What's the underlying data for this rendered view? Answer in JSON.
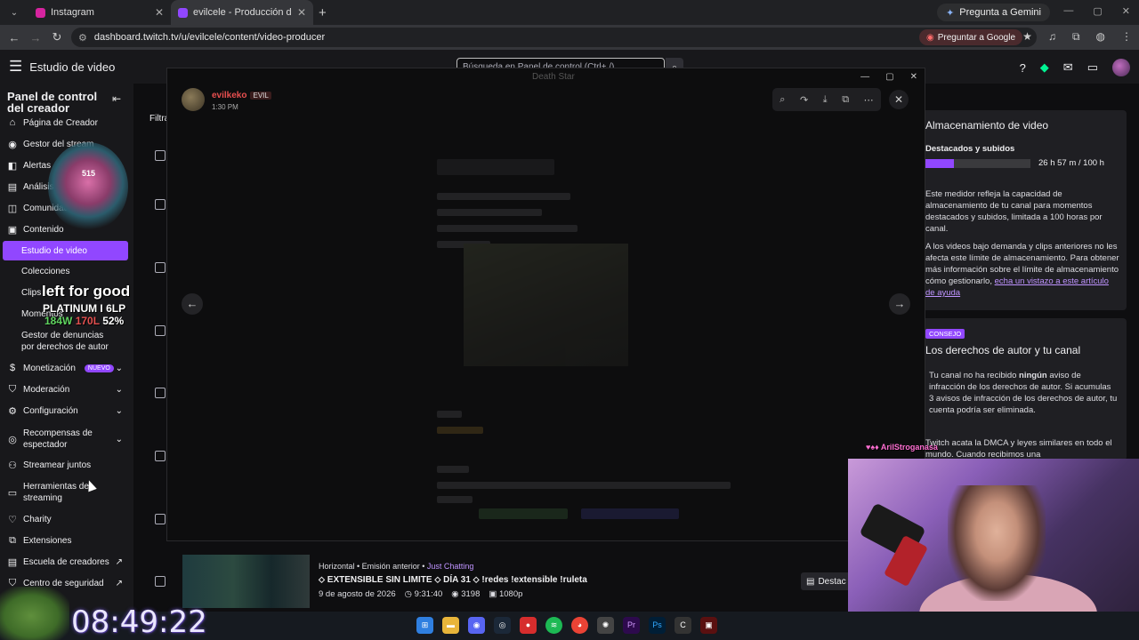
{
  "browser": {
    "tabs": [
      {
        "title": "Instagram",
        "color": "#d6249f"
      },
      {
        "title": "evilcele - Producción de video",
        "color": "#9147ff"
      }
    ],
    "gemini_label": "Pregunta a Gemini",
    "url": "dashboard.twitch.tv/u/evilcele/content/video-producer",
    "google_label": "Preguntar a Google"
  },
  "twitch": {
    "title": "Estudio de video",
    "search_placeholder": "Búsqueda en Panel de control (Ctrl+ /)"
  },
  "sidebar": {
    "heading": "Panel de control del creador",
    "items": [
      {
        "label": "Página de Creador",
        "icon": "home-icon"
      },
      {
        "label": "Gestor del stream",
        "icon": "broadcast-icon"
      },
      {
        "label": "Alertas",
        "icon": "alert-icon"
      },
      {
        "label": "Análisis",
        "icon": "analytics-icon"
      },
      {
        "label": "Comunidad",
        "icon": "community-icon"
      },
      {
        "label": "Contenido",
        "icon": "content-icon"
      }
    ],
    "sub_items": [
      "Estudio de video",
      "Colecciones",
      "Clips",
      "Momentos",
      "Gestor de denuncias",
      "por derechos de autor"
    ],
    "lower_items": [
      {
        "label": "Monetización",
        "badge": "NUEVO"
      },
      {
        "label": "Moderación"
      },
      {
        "label": "Configuración"
      },
      {
        "label": "Recompensas de",
        "label2": "espectador"
      },
      {
        "label": "Streamear juntos"
      },
      {
        "label": "Herramientas de",
        "label2": "streaming"
      },
      {
        "label": "Charity"
      },
      {
        "label": "Extensiones"
      },
      {
        "label": "Escuela de creadores"
      },
      {
        "label": "Centro de seguridad"
      }
    ],
    "filter_label": "Filtra"
  },
  "modal": {
    "user": "evilkeko",
    "tag": "EVIL",
    "time": "1:30 PM",
    "top_title": "Death Star"
  },
  "rpanel": {
    "storage_title": "Almacenamiento de video",
    "storage_sub": "Destacados y subidos",
    "storage_usage": "26 h 57 m / 100 h",
    "storage_fraction": 0.27,
    "storage_text": "Este medidor refleja la capacidad de almacenamiento de tu canal para momentos destacados y subidos, limitada a 100 horas por canal.",
    "storage_text2": "A los videos bajo demanda y clips anteriores no les afecta este límite de almacenamiento. Para obtener más información sobre el límite de almacenamiento cómo gestionarlo,",
    "storage_link": "echa un vistazo a este artículo de ayuda",
    "consejo": "CONSEJO",
    "copyright_title": "Los derechos de autor y tu canal",
    "copyright_text_a": "Tu canal no ha recibido",
    "copyright_bold": "ningún",
    "copyright_text_b": "aviso de infracción de los derechos de autor. Si acumulas 3 avisos de infracción de los derechos de autor, tu cuenta podría ser eliminada.",
    "copyright_text2": "Twitch acata la DMCA y leyes similares en todo el mundo. Cuando recibimos una"
  },
  "video_row": {
    "meta_type": "Horizontal • Emisión anterior •",
    "category": "Just Chatting",
    "title": "⬦ EXTENSIBLE SIN LIMITE ⬦ DÍA 31 ⬦ !redes !extensible !ruleta",
    "date": "9 de agosto de 2026",
    "duration": "9:31:40",
    "views": "3198",
    "quality": "1080p",
    "destacar": "Destac"
  },
  "overlays": {
    "rank_level": "515",
    "left_for_good": "left for good",
    "platinum": "PLATINUM I 6LP",
    "wins": "184W",
    "losses": "170L",
    "pct": "52%",
    "clock": "08:49:22",
    "chat_user": "AriIStroganasa"
  }
}
